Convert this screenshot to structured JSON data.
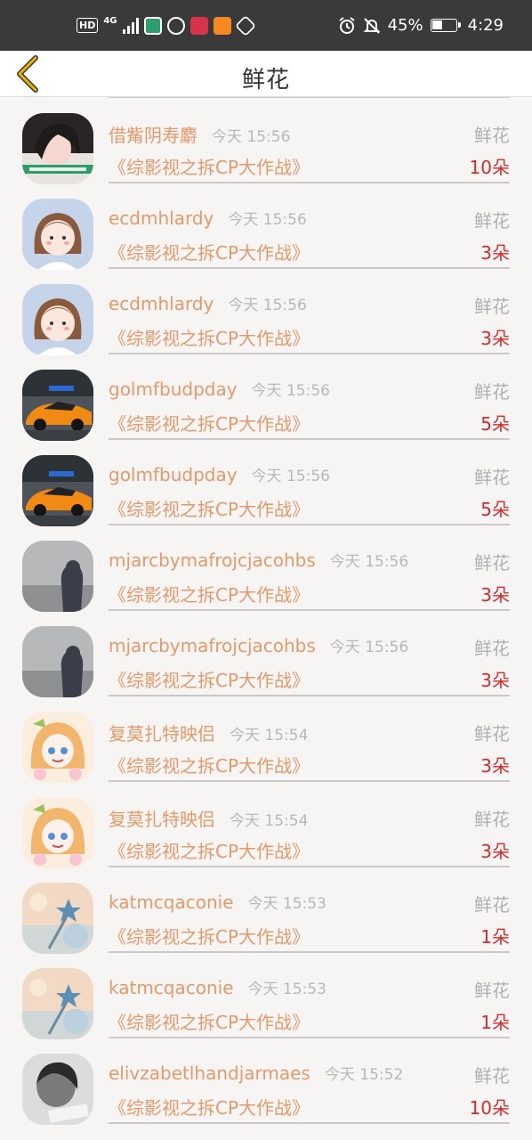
{
  "status_bar": {
    "hd": "HD",
    "net": "4G",
    "battery": "45%",
    "battery_level": 0.45,
    "time": "4:29"
  },
  "header": {
    "title": "鲜花",
    "back_icon": "chevron-left-icon"
  },
  "colors": {
    "name": "#e39a6a",
    "quantity": "#d42c2c",
    "muted": "#b8b8b8",
    "back": "#e9b500"
  },
  "rows": [
    {
      "user": "借觜阴寿麝",
      "time": "今天 15:56",
      "label": "鲜花",
      "show": "《综影视之拆CP大作战》",
      "qty": "10朵",
      "avatar": "girl-photo"
    },
    {
      "user": "ecdmhlardy",
      "time": "今天 15:56",
      "label": "鲜花",
      "show": "《综影视之拆CP大作战》",
      "qty": "3朵",
      "avatar": "cartoon-girl"
    },
    {
      "user": "ecdmhlardy",
      "time": "今天 15:56",
      "label": "鲜花",
      "show": "《综影视之拆CP大作战》",
      "qty": "3朵",
      "avatar": "cartoon-girl"
    },
    {
      "user": "golmfbudpday",
      "time": "今天 15:56",
      "label": "鲜花",
      "show": "《综影视之拆CP大作战》",
      "qty": "5朵",
      "avatar": "orange-car"
    },
    {
      "user": "golmfbudpday",
      "time": "今天 15:56",
      "label": "鲜花",
      "show": "《综影视之拆CP大作战》",
      "qty": "5朵",
      "avatar": "orange-car"
    },
    {
      "user": "mjarcbymafrojcjacohbs",
      "time": "今天 15:56",
      "label": "鲜花",
      "show": "《综影视之拆CP大作战》",
      "qty": "3朵",
      "avatar": "fog-figure"
    },
    {
      "user": "mjarcbymafrojcjacohbs",
      "time": "今天 15:56",
      "label": "鲜花",
      "show": "《综影视之拆CP大作战》",
      "qty": "3朵",
      "avatar": "fog-figure"
    },
    {
      "user": "复莫扎特映侣",
      "time": "今天 15:54",
      "label": "鲜花",
      "show": "《综影视之拆CP大作战》",
      "qty": "3朵",
      "avatar": "anime-girl"
    },
    {
      "user": "复莫扎特映侣",
      "time": "今天 15:54",
      "label": "鲜花",
      "show": "《综影视之拆CP大作战》",
      "qty": "3朵",
      "avatar": "anime-girl"
    },
    {
      "user": "katmcqaconie",
      "time": "今天 15:53",
      "label": "鲜花",
      "show": "《综影视之拆CP大作战》",
      "qty": "1朵",
      "avatar": "star-wand"
    },
    {
      "user": "katmcqaconie",
      "time": "今天 15:53",
      "label": "鲜花",
      "show": "《综影视之拆CP大作战》",
      "qty": "1朵",
      "avatar": "star-wand"
    },
    {
      "user": "elivzabetlhandjarmaes",
      "time": "今天 15:52",
      "label": "鲜花",
      "show": "《综影视之拆CP大作战》",
      "qty": "10朵",
      "avatar": "bw-photo"
    }
  ]
}
